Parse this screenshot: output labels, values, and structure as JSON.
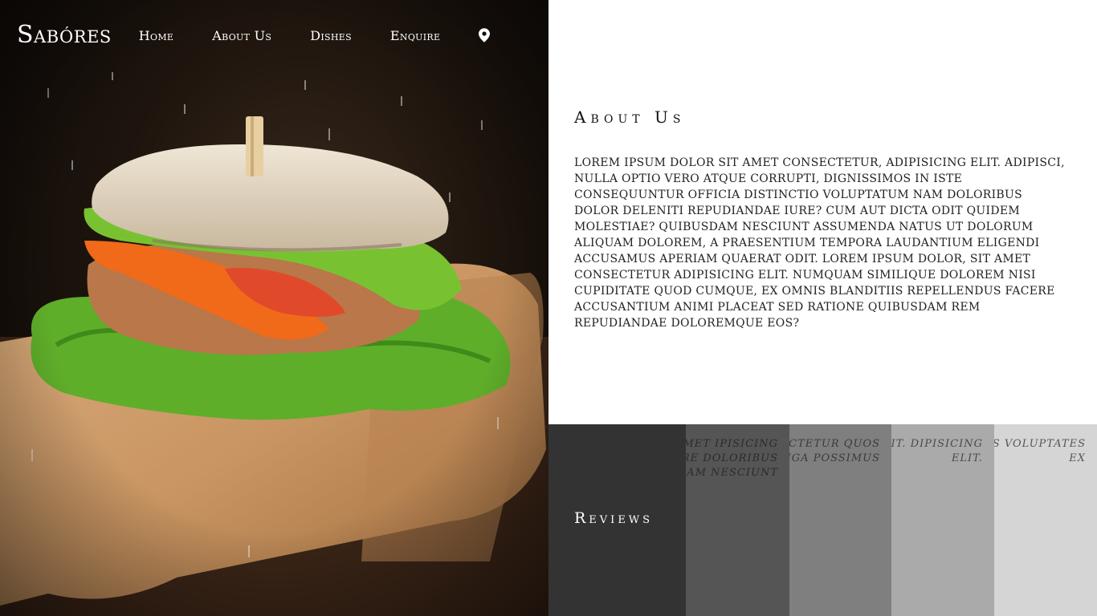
{
  "brand": {
    "name": "Sabóres"
  },
  "nav": {
    "items": [
      {
        "label": "Home"
      },
      {
        "label": "About Us"
      },
      {
        "label": "Dishes"
      },
      {
        "label": "Enquire"
      }
    ],
    "location_icon": "map-pin-icon"
  },
  "hero": {
    "image": "sandwich-on-cutting-board"
  },
  "about": {
    "title": "About Us",
    "body": "Lorem ipsum dolor sit amet consectetur, adipisicing elit. Adipisci, nulla optio vero atque corrupti, dignissimos in iste consequuntur officia distinctio voluptatum nam doloribus dolor deleniti repudiandae iure? Cum aut dicta odit quidem molestiae? Quibusdam nesciunt assumenda natus ut dolorum aliquam dolorem, a praesentium tempora laudantium eligendi accusamus aperiam quaerat odit. Lorem ipsum dolor, sit amet consectetur adipisicing elit. Numquam similique dolorem nisi cupiditate quod cumque, ex omnis blanditiis repellendus facere accusantium animi placeat sed ratione quibusdam rem repudiandae doloremque eos?"
  },
  "reviews": {
    "label": "Reviews",
    "cards": [
      {
        "text": "lor sit amet ipisicing elit labore doloribus niam eum am nesciunt"
      },
      {
        "text": "consectetur quos fuga possimus"
      },
      {
        "text": "dipisicing elit. dipisicing elit."
      },
      {
        "text": "ctus veritatis voluptates ex"
      }
    ]
  },
  "colors": {
    "reviews_panel": "#333333",
    "card_1": "#555555",
    "card_2": "#7f7f7f",
    "card_3": "#aaaaaa",
    "card_4": "#d5d5d5"
  }
}
